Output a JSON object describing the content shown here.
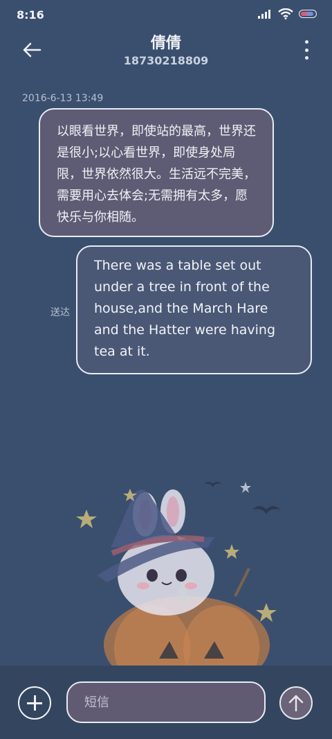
{
  "status": {
    "time": "8:16"
  },
  "header": {
    "contact_name": "倩倩",
    "phone": "18730218809"
  },
  "messages": {
    "timestamp": "2016-6-13 13:49",
    "incoming_text": "以眼看世界，即使站的最高，世界还是很小;以心看世界，即使身处局限，世界依然很大。生活远不完美，需要用心去体会;无需拥有太多，愿快乐与你相随。",
    "outgoing_text": "There was a table set out under a tree in front of the house,and the March Hare and the Hatter were having tea at it.",
    "outgoing_status": "送达"
  },
  "composer": {
    "placeholder": "短信"
  },
  "icons": {
    "back": "arrow-left-icon",
    "more": "more-vertical-icon",
    "add": "plus-circle-icon",
    "send": "arrow-up-icon",
    "signal": "signal-icon",
    "wifi": "wifi-icon",
    "battery": "battery-icon"
  },
  "colors": {
    "background": "#3a4f6e",
    "incoming_bubble": "#5e5c74",
    "outgoing_bubble": "#4a5876",
    "bubble_border": "#e8ecf2",
    "composer_bar": "#34465f"
  }
}
